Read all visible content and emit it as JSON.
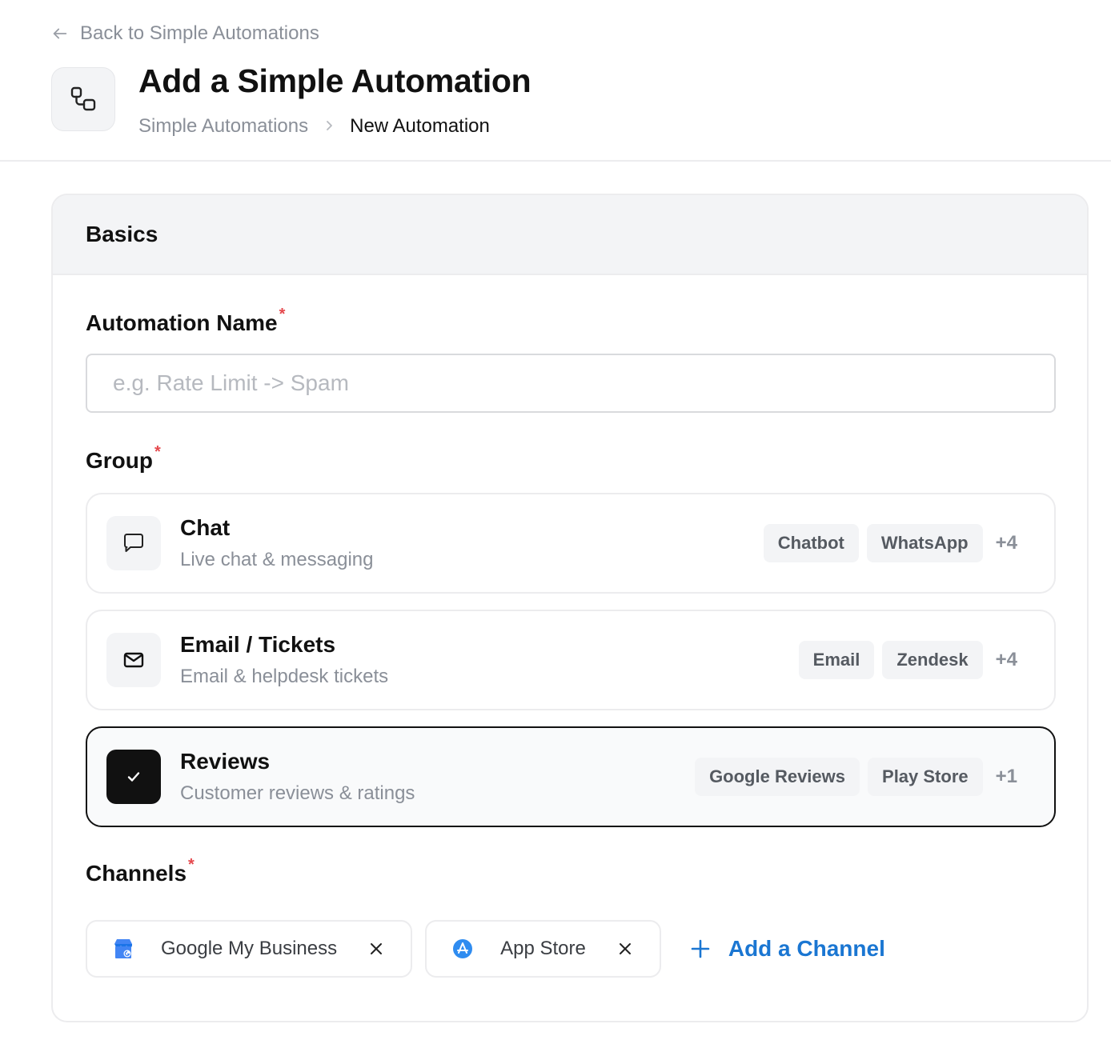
{
  "header": {
    "back_label": "Back to Simple Automations",
    "title": "Add a Simple Automation",
    "breadcrumb": [
      "Simple Automations",
      "New Automation"
    ],
    "page_icon": "workflow-icon"
  },
  "basics": {
    "section_title": "Basics",
    "name_field": {
      "label": "Automation Name",
      "required_mark": "*",
      "value": "",
      "placeholder": "e.g. Rate Limit -> Spam"
    },
    "group": {
      "label": "Group",
      "required_mark": "*",
      "options": [
        {
          "title": "Chat",
          "description": "Live chat & messaging",
          "icon": "chat-bubble-icon",
          "tags": [
            "Chatbot",
            "WhatsApp"
          ],
          "more": "+4",
          "selected": false
        },
        {
          "title": "Email / Tickets",
          "description": "Email & helpdesk tickets",
          "icon": "mail-icon",
          "tags": [
            "Email",
            "Zendesk"
          ],
          "more": "+4",
          "selected": false
        },
        {
          "title": "Reviews",
          "description": "Customer reviews & ratings",
          "icon": "check-icon",
          "tags": [
            "Google Reviews",
            "Play Store"
          ],
          "more": "+1",
          "selected": true
        }
      ]
    },
    "channels": {
      "label": "Channels",
      "required_mark": "*",
      "selected": [
        {
          "name": "Google My Business",
          "icon": "google-my-business-icon"
        },
        {
          "name": "App Store",
          "icon": "app-store-icon"
        }
      ],
      "add_label": "Add a Channel"
    }
  },
  "colors": {
    "accent": "#1a76d2",
    "required": "#e5484d",
    "selected_border": "#111111"
  }
}
